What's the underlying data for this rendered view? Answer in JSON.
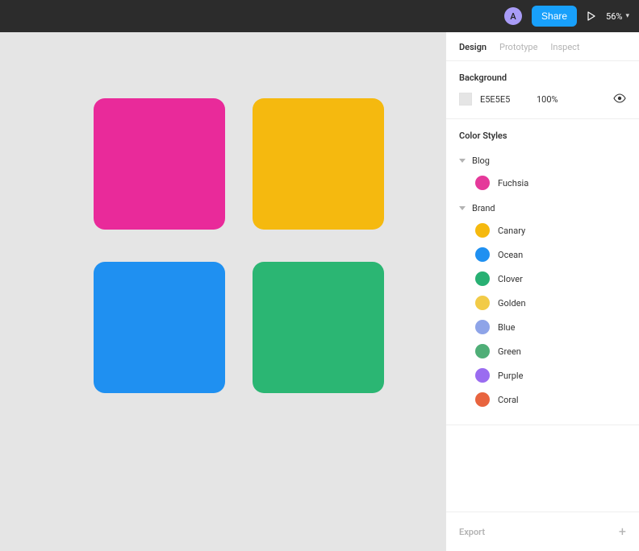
{
  "topbar": {
    "avatar_initial": "A",
    "share_label": "Share",
    "zoom_label": "56%"
  },
  "panel": {
    "tabs": {
      "design": "Design",
      "prototype": "Prototype",
      "inspect": "Inspect"
    },
    "background": {
      "heading": "Background",
      "hex": "E5E5E5",
      "opacity": "100%",
      "swatch_color": "#e5e5e5"
    },
    "color_styles": {
      "heading": "Color Styles",
      "groups": [
        {
          "label": "Blog",
          "styles": [
            {
              "name": "Fuchsia",
              "color": "#e5399a"
            }
          ]
        },
        {
          "label": "Brand",
          "styles": [
            {
              "name": "Canary",
              "color": "#f5b90f"
            },
            {
              "name": "Ocean",
              "color": "#1f90f1"
            },
            {
              "name": "Clover",
              "color": "#28b073"
            },
            {
              "name": "Golden",
              "color": "#f2cb47"
            },
            {
              "name": "Blue",
              "color": "#8ea4e8"
            },
            {
              "name": "Green",
              "color": "#4fae77"
            },
            {
              "name": "Purple",
              "color": "#9a6cf0"
            },
            {
              "name": "Coral",
              "color": "#e8643f"
            }
          ]
        }
      ]
    },
    "export_label": "Export"
  },
  "canvas": {
    "background": "#e5e5e5",
    "shapes": [
      {
        "color": "#e92a9a"
      },
      {
        "color": "#f5b90f"
      },
      {
        "color": "#1f90f1"
      },
      {
        "color": "#2bb673"
      }
    ]
  }
}
